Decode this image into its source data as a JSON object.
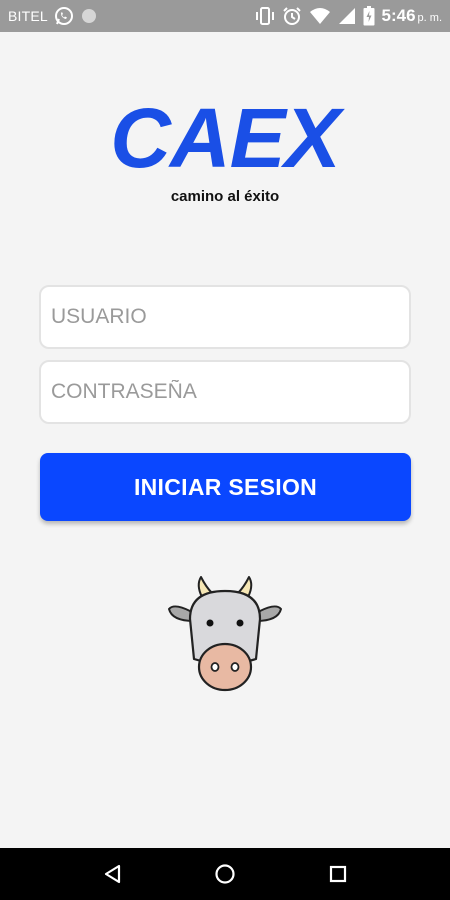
{
  "status_bar": {
    "carrier": "BITEL",
    "time": "5:46",
    "ampm": "p. m.",
    "icons": [
      "whatsapp-icon",
      "circle-icon",
      "vibrate-icon",
      "alarm-icon",
      "wifi-icon",
      "signal-icon",
      "battery-icon"
    ]
  },
  "app": {
    "logo": "CAEX",
    "tagline": "camino al éxito",
    "brand_color": "#1a4fe6"
  },
  "login_form": {
    "username_placeholder": "USUARIO",
    "password_placeholder": "CONTRASEÑA",
    "submit_label": "INICIAR SESION",
    "button_color": "#0a47ff"
  },
  "mascot": {
    "icon": "cow-icon"
  },
  "nav_bar": {
    "icons": [
      "back-icon",
      "home-icon",
      "recent-apps-icon"
    ]
  }
}
